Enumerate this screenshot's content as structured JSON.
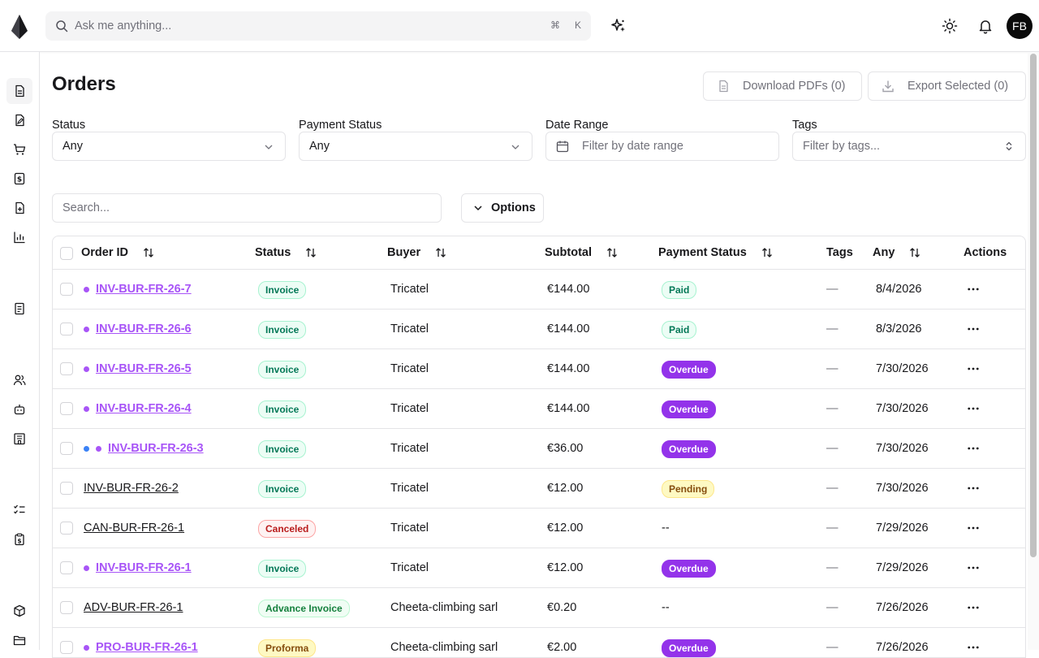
{
  "header": {
    "ask_placeholder": "Ask me anything...",
    "shortcut_mod": "⌘",
    "shortcut_key": "K",
    "avatar_initials": "FB"
  },
  "page": {
    "title": "Orders",
    "download_pdfs": "Download PDFs (0)",
    "export_selected": "Export Selected (0)"
  },
  "filters": {
    "status_label": "Status",
    "status_value": "Any",
    "payment_label": "Payment Status",
    "payment_value": "Any",
    "date_label": "Date Range",
    "date_placeholder": "Filter by date range",
    "tags_label": "Tags",
    "tags_placeholder": "Filter by tags..."
  },
  "toolbar": {
    "search_placeholder": "Search...",
    "options_label": "Options"
  },
  "table": {
    "columns": {
      "order_id": "Order ID",
      "status": "Status",
      "buyer": "Buyer",
      "subtotal": "Subtotal",
      "payment_status": "Payment Status",
      "tags": "Tags",
      "date": "Any",
      "actions": "Actions"
    },
    "rows": [
      {
        "id": "INV-BUR-FR-26-7",
        "dots": [
          "#a855f7"
        ],
        "link": true,
        "status": "Invoice",
        "status_kind": "invoice",
        "buyer": "Tricatel",
        "subtotal": "€144.00",
        "payment": "Paid",
        "payment_kind": "paid",
        "tags": "—",
        "date": "8/4/2026"
      },
      {
        "id": "INV-BUR-FR-26-6",
        "dots": [
          "#a855f7"
        ],
        "link": true,
        "status": "Invoice",
        "status_kind": "invoice",
        "buyer": "Tricatel",
        "subtotal": "€144.00",
        "payment": "Paid",
        "payment_kind": "paid",
        "tags": "—",
        "date": "8/3/2026"
      },
      {
        "id": "INV-BUR-FR-26-5",
        "dots": [
          "#a855f7"
        ],
        "link": true,
        "status": "Invoice",
        "status_kind": "invoice",
        "buyer": "Tricatel",
        "subtotal": "€144.00",
        "payment": "Overdue",
        "payment_kind": "overdue",
        "tags": "—",
        "date": "7/30/2026"
      },
      {
        "id": "INV-BUR-FR-26-4",
        "dots": [
          "#a855f7"
        ],
        "link": true,
        "status": "Invoice",
        "status_kind": "invoice",
        "buyer": "Tricatel",
        "subtotal": "€144.00",
        "payment": "Overdue",
        "payment_kind": "overdue",
        "tags": "—",
        "date": "7/30/2026"
      },
      {
        "id": "INV-BUR-FR-26-3",
        "dots": [
          "#3b82f6",
          "#a855f7"
        ],
        "link": true,
        "status": "Invoice",
        "status_kind": "invoice",
        "buyer": "Tricatel",
        "subtotal": "€36.00",
        "payment": "Overdue",
        "payment_kind": "overdue",
        "tags": "—",
        "date": "7/30/2026"
      },
      {
        "id": "INV-BUR-FR-26-2",
        "dots": [],
        "link": false,
        "status": "Invoice",
        "status_kind": "invoice",
        "buyer": "Tricatel",
        "subtotal": "€12.00",
        "payment": "Pending",
        "payment_kind": "pending",
        "tags": "—",
        "date": "7/30/2026"
      },
      {
        "id": "CAN-BUR-FR-26-1",
        "dots": [],
        "link": false,
        "status": "Canceled",
        "status_kind": "canceled",
        "buyer": "Tricatel",
        "subtotal": "€12.00",
        "payment": "--",
        "payment_kind": "none",
        "tags": "—",
        "date": "7/29/2026"
      },
      {
        "id": "INV-BUR-FR-26-1",
        "dots": [
          "#a855f7"
        ],
        "link": true,
        "status": "Invoice",
        "status_kind": "invoice",
        "buyer": "Tricatel",
        "subtotal": "€12.00",
        "payment": "Overdue",
        "payment_kind": "overdue",
        "tags": "—",
        "date": "7/29/2026"
      },
      {
        "id": "ADV-BUR-FR-26-1",
        "dots": [],
        "link": false,
        "status": "Advance Invoice",
        "status_kind": "advance",
        "buyer": "Cheeta-climbing sarl",
        "subtotal": "€0.20",
        "payment": "--",
        "payment_kind": "none",
        "tags": "—",
        "date": "7/26/2026"
      },
      {
        "id": "PRO-BUR-FR-26-1",
        "dots": [
          "#a855f7"
        ],
        "link": true,
        "status": "Proforma",
        "status_kind": "proforma",
        "buyer": "Cheeta-climbing sarl",
        "subtotal": "€2.00",
        "payment": "Overdue",
        "payment_kind": "overdue",
        "tags": "—",
        "date": "7/26/2026"
      }
    ]
  },
  "icons": {
    "logo": "logo-icon",
    "rail": [
      "document-icon",
      "edit-document-icon",
      "cart-icon",
      "dollar-document-icon",
      "add-document-icon",
      "bar-chart-icon",
      "receipt-icon",
      "users-icon",
      "bot-icon",
      "building-icon",
      "checklist-icon",
      "clipboard-icon",
      "package-icon",
      "folder-icon"
    ]
  }
}
